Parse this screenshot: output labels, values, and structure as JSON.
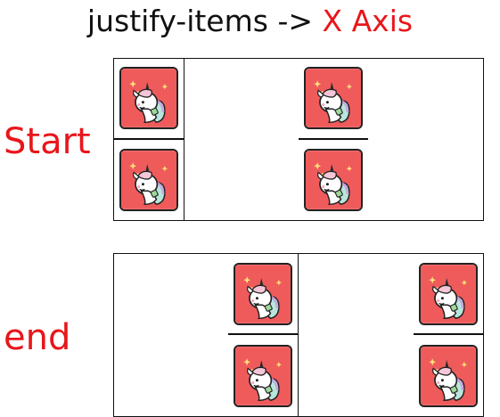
{
  "title": {
    "prefix": "justify-items -> ",
    "axis": "X Axis"
  },
  "rows": {
    "start_label": "Start",
    "end_label": "end"
  },
  "colors": {
    "title_text": "#111111",
    "accent_red": "#e8161b",
    "tile_bg": "#ef5b5b",
    "grid_border": "#111111"
  },
  "grids": [
    {
      "justify": "start",
      "cells": [
        "unicorn-icon",
        "unicorn-icon",
        "unicorn-icon",
        "unicorn-icon"
      ]
    },
    {
      "justify": "end",
      "cells": [
        "unicorn-icon",
        "unicorn-icon",
        "unicorn-icon",
        "unicorn-icon"
      ]
    }
  ]
}
